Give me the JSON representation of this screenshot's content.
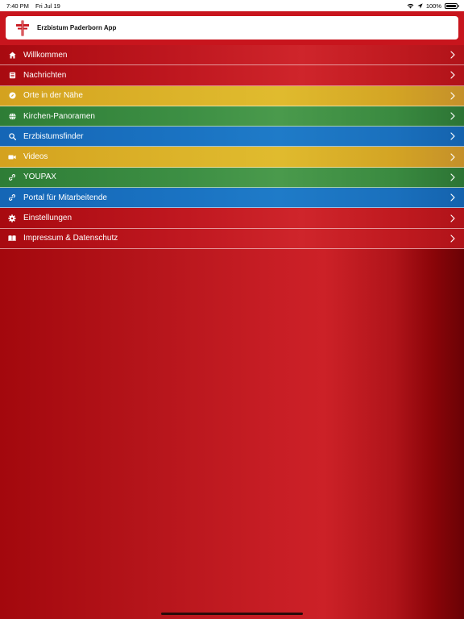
{
  "status": {
    "time": "7:40 PM",
    "date": "Fri Jul 19",
    "battery": "100%"
  },
  "app": {
    "title": "Erzbistum Paderborn App"
  },
  "menu": [
    {
      "label": "Willkommen",
      "icon": "home-icon",
      "theme": "red"
    },
    {
      "label": "Nachrichten",
      "icon": "newspaper-icon",
      "theme": "red"
    },
    {
      "label": "Orte in der Nähe",
      "icon": "compass-icon",
      "theme": "yellow"
    },
    {
      "label": "Kirchen-Panoramen",
      "icon": "globe-icon",
      "theme": "green"
    },
    {
      "label": "Erzbistumsfinder",
      "icon": "search-icon",
      "theme": "blue"
    },
    {
      "label": "Videos",
      "icon": "video-camera-icon",
      "theme": "yellow"
    },
    {
      "label": "YOUPAX",
      "icon": "link-icon",
      "theme": "green"
    },
    {
      "label": "Portal für Mitarbeitende",
      "icon": "link-icon",
      "theme": "blue"
    },
    {
      "label": "Einstellungen",
      "icon": "gear-icon",
      "theme": "red"
    },
    {
      "label": "Impressum & Datenschutz",
      "icon": "book-icon",
      "theme": "red"
    }
  ]
}
